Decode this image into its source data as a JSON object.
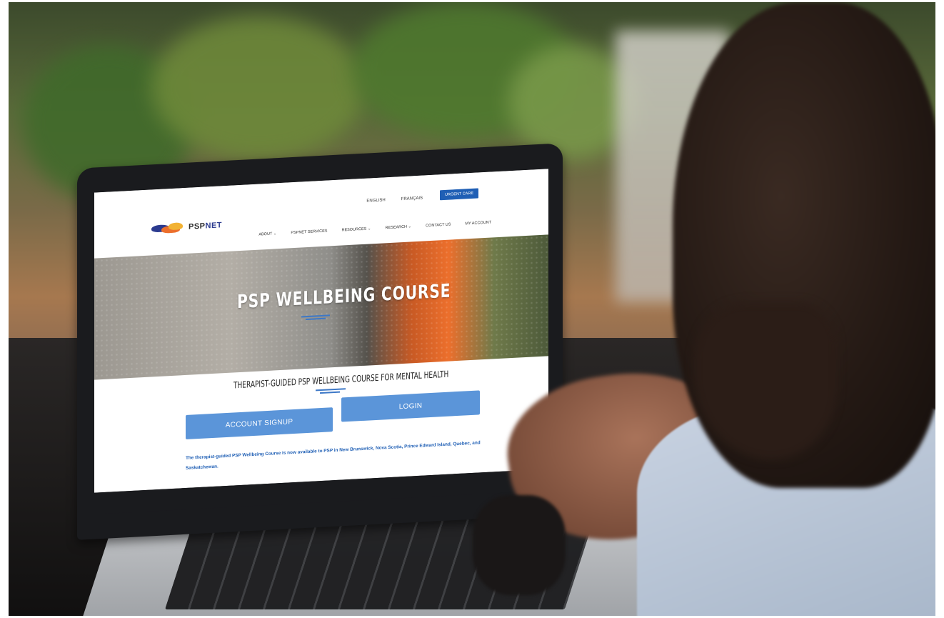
{
  "site": {
    "logo": {
      "prefix": "PSP",
      "suffix": "NET"
    },
    "top_nav": {
      "english": "ENGLISH",
      "french": "FRANÇAIS"
    },
    "urgent_button": "URGENT CARE",
    "main_nav": [
      {
        "label": "ABOUT ⌄"
      },
      {
        "label": "PSPNET SERVICES"
      },
      {
        "label": "RESOURCES ⌄"
      },
      {
        "label": "RESEARCH ⌄"
      },
      {
        "label": "CONTACT US"
      },
      {
        "label": "MY ACCOUNT"
      }
    ],
    "hero_title": "PSP WELLBEING COURSE",
    "subtitle": "THERAPIST-GUIDED PSP WELLBEING COURSE FOR MENTAL HEALTH",
    "buttons": {
      "signup": "ACCOUNT SIGNUP",
      "login": "LOGIN"
    },
    "notice": "The therapist-guided PSP Wellbeing Course is now available to PSP in New Brunswick, Nova Scotia, Prince Edward Island, Quebec, and Saskatchewan."
  },
  "colors": {
    "accent": "#1f5fb5",
    "button": "#5b95d9",
    "orange": "#ec6f2c"
  },
  "icons": {
    "logo_mark": "pspnet-wave-logo"
  }
}
